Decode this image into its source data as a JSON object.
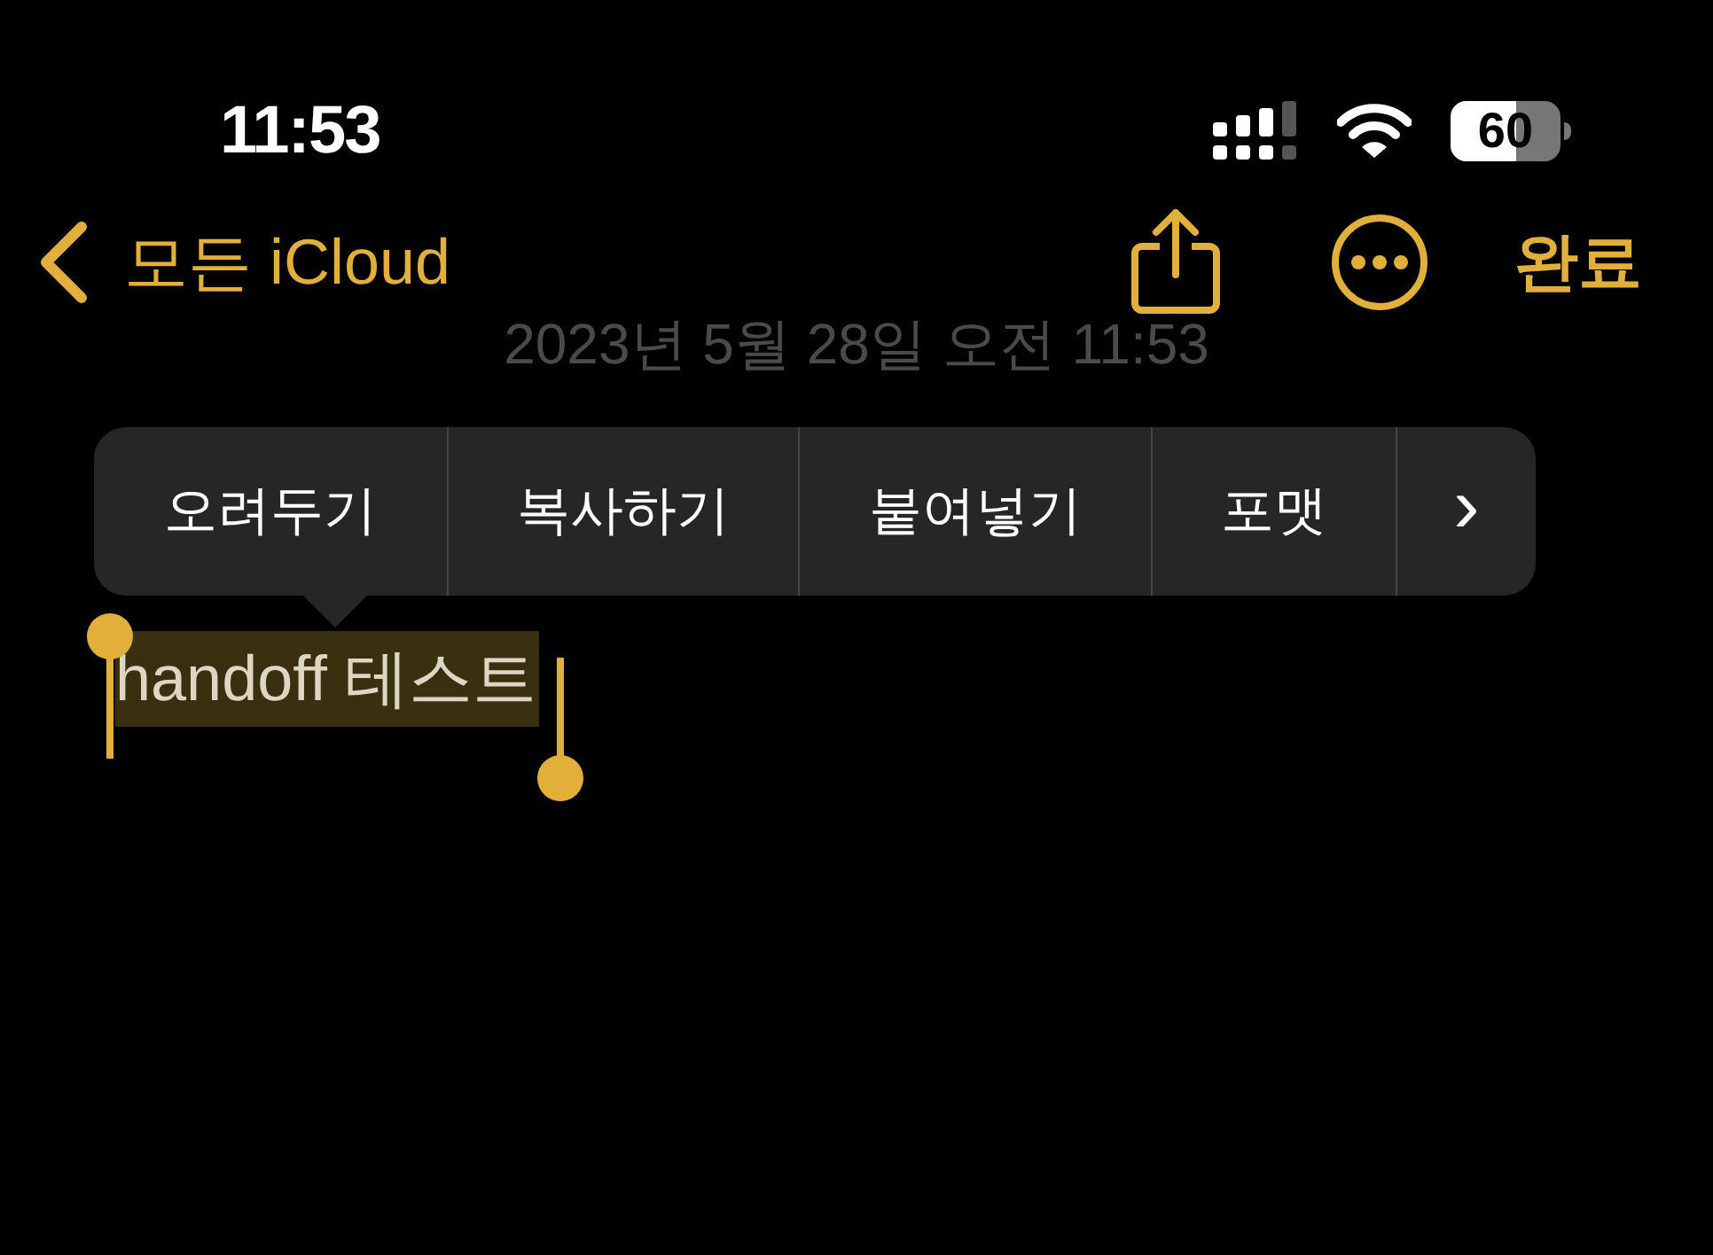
{
  "status_bar": {
    "time": "11:53",
    "battery": "60"
  },
  "nav": {
    "back_label": "모든 iCloud",
    "done": "완료"
  },
  "note": {
    "date": "2023년 5월 28일 오전 11:53",
    "selected_text": "handoff 테스트"
  },
  "edit_menu": {
    "items": [
      {
        "label": "오려두기",
        "kind": "text"
      },
      {
        "label": "복사하기",
        "kind": "text"
      },
      {
        "label": "붙여넣기",
        "kind": "text"
      },
      {
        "label": "포맷",
        "kind": "text"
      },
      {
        "label": "›",
        "kind": "more"
      }
    ]
  }
}
